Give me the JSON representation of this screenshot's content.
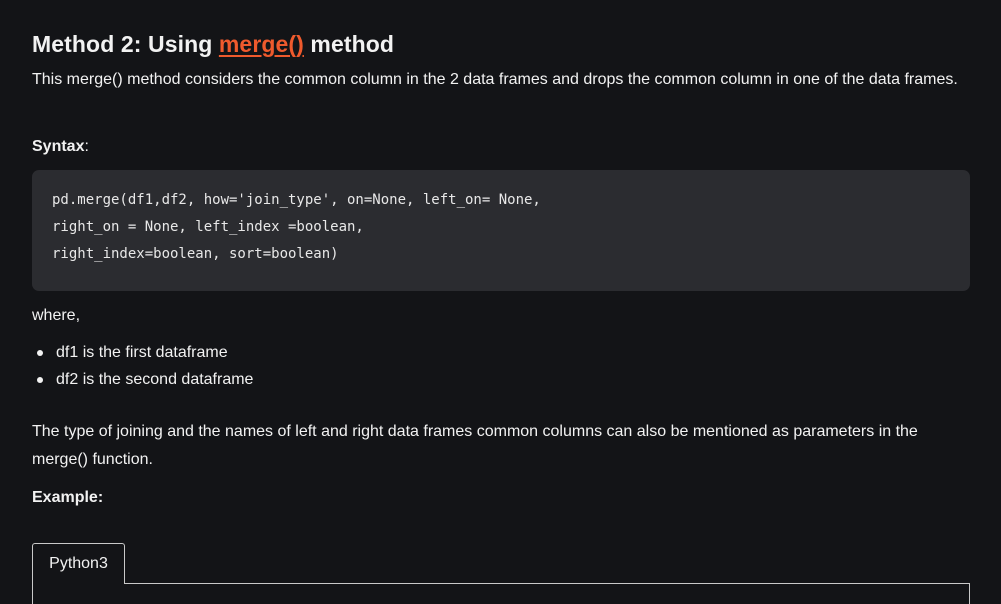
{
  "heading": {
    "prefix": "Method 2:  Using ",
    "link": "merge()",
    "suffix": " method"
  },
  "intro": "This merge() method considers the common column in the 2 data frames and drops the common column in one of the data frames.",
  "syntax_label": "Syntax",
  "syntax_colon": ":",
  "code_lines": [
    "pd.merge(df1,df2, how='join_type', on=None, left_on= None,",
    "right_on = None, left_index =boolean,",
    "right_index=boolean, sort=boolean)"
  ],
  "where_text": "where,",
  "bullets": [
    "df1 is the first dataframe",
    "df2 is the second dataframe"
  ],
  "joining_text": "The type of joining and the names of left and right data frames common columns can also be mentioned as parameters in the merge() function.",
  "example_label": "Example:",
  "tabs": [
    {
      "label": "Python3"
    }
  ],
  "colors": {
    "background": "#131417",
    "code_background": "#2b2c30",
    "link": "#ef5a2d",
    "text": "#f2f2f2"
  }
}
